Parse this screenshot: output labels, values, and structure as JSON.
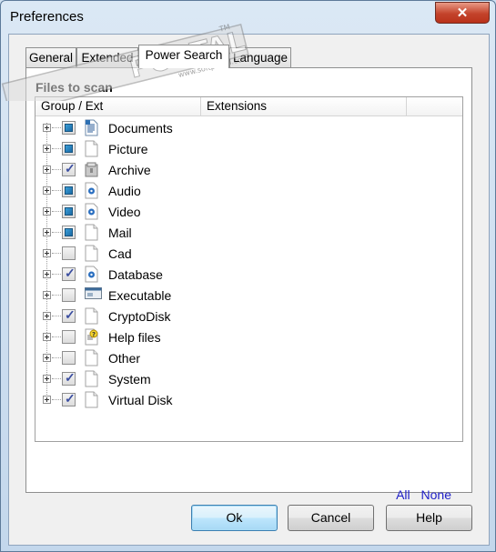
{
  "window": {
    "title": "Preferences",
    "close_glyph": "✕"
  },
  "tabs": [
    {
      "label": "General",
      "active": false
    },
    {
      "label": "Extended",
      "active": false
    },
    {
      "label": "Power Search",
      "active": true
    },
    {
      "label": "Language",
      "active": false
    }
  ],
  "panel": {
    "section_title": "Files to scan",
    "columns": [
      "Group / Ext",
      "Extensions"
    ],
    "rows": [
      {
        "label": "Documents",
        "check": "full",
        "icon": "document-icon"
      },
      {
        "label": "Picture",
        "check": "full",
        "icon": "blank-file-icon"
      },
      {
        "label": "Archive",
        "check": "checked",
        "icon": "archive-icon"
      },
      {
        "label": "Audio",
        "check": "full",
        "icon": "media-file-icon"
      },
      {
        "label": "Video",
        "check": "full",
        "icon": "media-file-icon"
      },
      {
        "label": "Mail",
        "check": "full",
        "icon": "blank-file-icon"
      },
      {
        "label": "Cad",
        "check": "none",
        "icon": "blank-file-icon"
      },
      {
        "label": "Database",
        "check": "checked",
        "icon": "media-file-icon"
      },
      {
        "label": "Executable",
        "check": "none",
        "icon": "executable-icon"
      },
      {
        "label": "CryptoDisk",
        "check": "checked",
        "icon": "blank-file-icon"
      },
      {
        "label": "Help files",
        "check": "none",
        "icon": "help-file-icon"
      },
      {
        "label": "Other",
        "check": "none",
        "icon": "blank-file-icon"
      },
      {
        "label": "System",
        "check": "checked",
        "icon": "blank-file-icon"
      },
      {
        "label": "Virtual Disk",
        "check": "checked",
        "icon": "blank-file-icon"
      }
    ],
    "links": {
      "all": "All",
      "none": "None"
    }
  },
  "buttons": {
    "ok": "Ok",
    "cancel": "Cancel",
    "help": "Help"
  },
  "watermark": {
    "text": "PORTAL",
    "sub": "www.softportal.com",
    "tm": "TM"
  },
  "colors": {
    "link": "#1f1fc8",
    "check_fill": "#1c6aa5",
    "titlebar": "#c3d7ec",
    "close": "#c4432b"
  }
}
